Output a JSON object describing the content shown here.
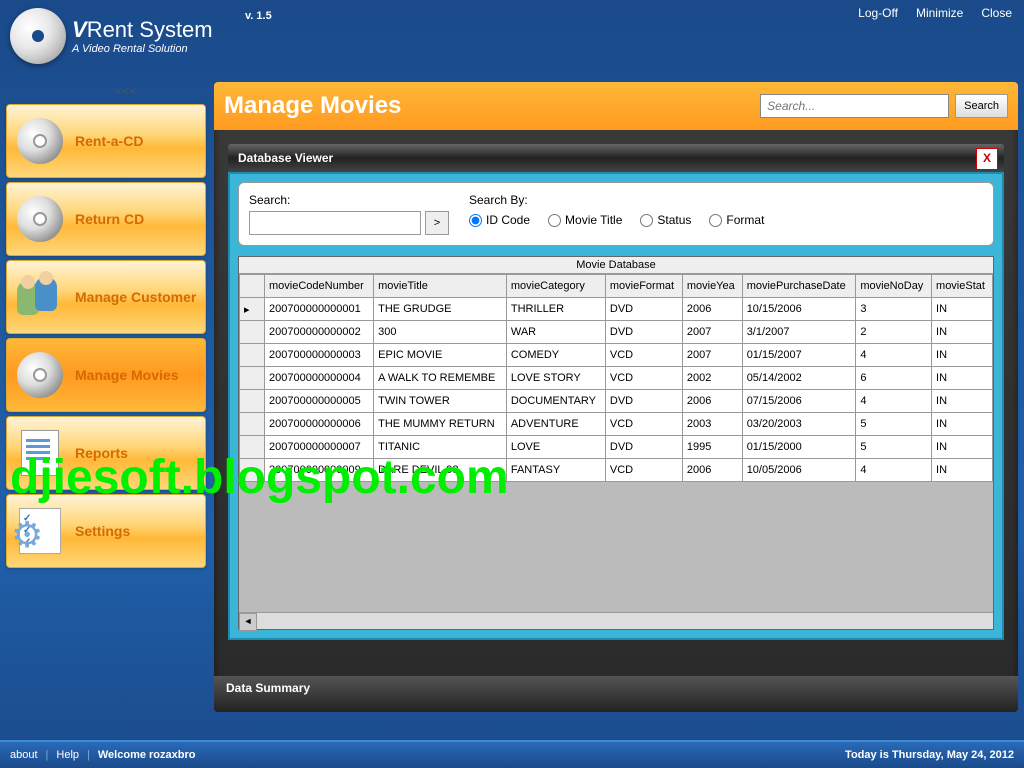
{
  "topbar": {
    "logoff": "Log-Off",
    "minimize": "Minimize",
    "close": "Close"
  },
  "logo": {
    "title_v": "V",
    "title_rest": "Rent System",
    "subtitle": "A Video Rental Solution",
    "version": "v. 1.5"
  },
  "collapse": "<<<",
  "sidebar": {
    "items": [
      {
        "label": "Rent-a-CD"
      },
      {
        "label": "Return CD"
      },
      {
        "label": "Manage Customer"
      },
      {
        "label": "Manage Movies"
      },
      {
        "label": "Reports"
      },
      {
        "label": "Settings"
      }
    ]
  },
  "page": {
    "title": "Manage Movies",
    "search_placeholder": "Search...",
    "search_btn": "Search"
  },
  "dbviewer": {
    "title": "Database Viewer",
    "close": "X",
    "search_label": "Search:",
    "searchby_label": "Search By:",
    "go": ">",
    "radios": [
      "ID Code",
      "Movie Title",
      "Status",
      "Format"
    ],
    "grid_title": "Movie Database",
    "columns": [
      "movieCodeNumber",
      "movieTitle",
      "movieCategory",
      "movieFormat",
      "movieYea",
      "moviePurchaseDate",
      "movieNoDay",
      "movieStat"
    ],
    "rows": [
      [
        "200700000000001",
        "THE GRUDGE",
        "THRILLER",
        "DVD",
        "2006",
        "10/15/2006",
        "3",
        "IN"
      ],
      [
        "200700000000002",
        "300",
        "WAR",
        "DVD",
        "2007",
        "3/1/2007",
        "2",
        "IN"
      ],
      [
        "200700000000003",
        "EPIC MOVIE",
        "COMEDY",
        "VCD",
        "2007",
        "01/15/2007",
        "4",
        "IN"
      ],
      [
        "200700000000004",
        "A WALK TO REMEMBE",
        "LOVE STORY",
        "VCD",
        "2002",
        "05/14/2002",
        "6",
        "IN"
      ],
      [
        "200700000000005",
        "TWIN TOWER",
        "DOCUMENTARY",
        "DVD",
        "2006",
        "07/15/2006",
        "4",
        "IN"
      ],
      [
        "200700000000006",
        "THE MUMMY RETURN",
        "ADVENTURE",
        "VCD",
        "2003",
        "03/20/2003",
        "5",
        "IN"
      ],
      [
        "200700000000007",
        "TITANIC",
        "LOVE",
        "DVD",
        "1995",
        "01/15/2000",
        "5",
        "IN"
      ],
      [
        "200700000000009",
        "DARE DEVIL 98",
        "FANTASY",
        "VCD",
        "2006",
        "10/05/2006",
        "4",
        "IN"
      ]
    ],
    "summary": "Data Summary"
  },
  "footer": {
    "about": "about",
    "help": "Help",
    "welcome": "Welcome rozaxbro",
    "date": "Today is Thursday, May 24, 2012"
  },
  "watermark": "djiesoft.blogspot.com"
}
